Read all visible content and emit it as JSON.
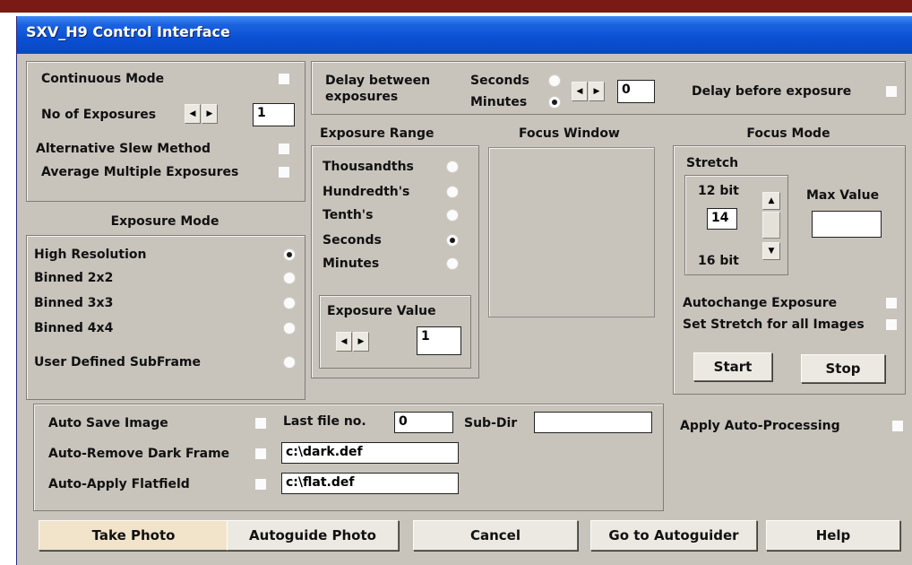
{
  "window": {
    "title": "SXV_H9 Control Interface"
  },
  "top_left": {
    "continuous_mode_label": "Continuous Mode",
    "no_of_exposures_label": "No of Exposures",
    "no_of_exposures_value": "1",
    "alt_slew_label": "Alternative Slew Method",
    "avg_multi_label": "Average Multiple Exposures"
  },
  "delay": {
    "between_label_1": "Delay between",
    "between_label_2": "exposures",
    "seconds_label": "Seconds",
    "minutes_label": "Minutes",
    "delay_value": "0",
    "before_label": "Delay before exposure"
  },
  "exposure_mode": {
    "heading": "Exposure Mode",
    "options": [
      "High Resolution",
      "Binned 2x2",
      "Binned 3x3",
      "Binned 4x4",
      "User Defined SubFrame"
    ],
    "selected": "High Resolution"
  },
  "exposure_range": {
    "heading": "Exposure Range",
    "options": [
      "Thousandths",
      "Hundredth's",
      "Tenth's",
      "Seconds",
      "Minutes"
    ],
    "selected": "Seconds",
    "value_label": "Exposure Value",
    "value": "1"
  },
  "focus_window": {
    "heading": "Focus Window"
  },
  "focus_mode": {
    "heading": "Focus Mode",
    "stretch_label": "Stretch",
    "bit12_label": "12 bit",
    "bit16_label": "16 bit",
    "stretch_value": "14",
    "max_value_label": "Max Value",
    "max_value": "",
    "autochange_label": "Autochange Exposure",
    "set_stretch_label": "Set Stretch for all Images",
    "start_label": "Start",
    "stop_label": "Stop"
  },
  "save": {
    "auto_save_label": "Auto Save Image",
    "last_file_label": "Last file no.",
    "last_file_value": "0",
    "subdir_label": "Sub-Dir",
    "subdir_value": "",
    "remove_dark_label": "Auto-Remove Dark Frame",
    "dark_path": "c:\\dark.def",
    "flatfield_label": "Auto-Apply Flatfield",
    "flat_path": "c:\\flat.def",
    "apply_auto_label": "Apply Auto-Processing"
  },
  "buttons": {
    "take_photo": "Take Photo",
    "autoguide_photo": "Autoguide Photo",
    "cancel": "Cancel",
    "go_to_autoguider": "Go to Autoguider",
    "help": "Help"
  },
  "colors": {
    "face": "#c8c4bc",
    "titlebar": "#0a4fd3",
    "pressed": "#f1e4cb"
  }
}
